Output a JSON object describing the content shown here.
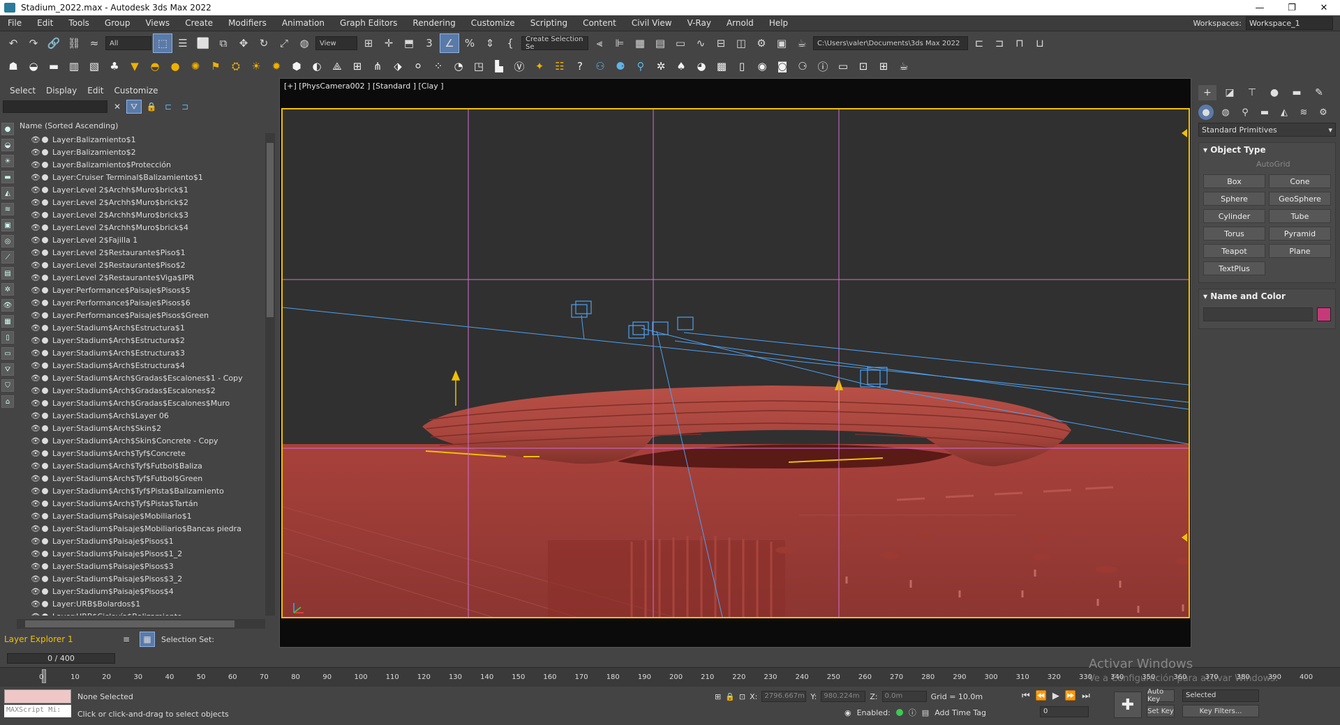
{
  "window": {
    "title": "Stadium_2022.max - Autodesk 3ds Max 2022",
    "min": "—",
    "restore": "❐",
    "close": "✕"
  },
  "menu": [
    "File",
    "Edit",
    "Tools",
    "Group",
    "Views",
    "Create",
    "Modifiers",
    "Animation",
    "Graph Editors",
    "Rendering",
    "Customize",
    "Scripting",
    "Content",
    "Civil View",
    "V-Ray",
    "Arnold",
    "Help"
  ],
  "workspace": {
    "label": "Workspaces:",
    "value": "Workspace_1"
  },
  "toolbar1": {
    "filter": "All",
    "view": "View",
    "selection_set": "Create Selection Se",
    "path": "C:\\Users\\valer\\Documents\\3ds Max 2022"
  },
  "scene_explorer": {
    "tabs": [
      "Select",
      "Display",
      "Edit",
      "Customize"
    ],
    "column_header": "Name (Sorted Ascending)",
    "layers": [
      "Layer:Balizamiento$1",
      "Layer:Balizamiento$2",
      "Layer:Balizamiento$Protección",
      "Layer:Cruiser Terminal$Balizamiento$1",
      "Layer:Level 2$Archh$Muro$brick$1",
      "Layer:Level 2$Archh$Muro$brick$2",
      "Layer:Level 2$Archh$Muro$brick$3",
      "Layer:Level 2$Archh$Muro$brick$4",
      "Layer:Level 2$Fajilla 1",
      "Layer:Level 2$Restaurante$Piso$1",
      "Layer:Level 2$Restaurante$Piso$2",
      "Layer:Level 2$Restaurante$Viga$IPR",
      "Layer:Performance$Paisaje$Pisos$5",
      "Layer:Performance$Paisaje$Pisos$6",
      "Layer:Performance$Paisaje$Pisos$Green",
      "Layer:Stadium$Arch$Estructura$1",
      "Layer:Stadium$Arch$Estructura$2",
      "Layer:Stadium$Arch$Estructura$3",
      "Layer:Stadium$Arch$Estructura$4",
      "Layer:Stadium$Arch$Gradas$Escalones$1 - Copy",
      "Layer:Stadium$Arch$Gradas$Escalones$2",
      "Layer:Stadium$Arch$Gradas$Escalones$Muro",
      "Layer:Stadium$Arch$Layer 06",
      "Layer:Stadium$Arch$Skin$2",
      "Layer:Stadium$Arch$Skin$Concrete - Copy",
      "Layer:Stadium$Arch$Tyf$Concrete",
      "Layer:Stadium$Arch$Tyf$Futbol$Baliza",
      "Layer:Stadium$Arch$Tyf$Futbol$Green",
      "Layer:Stadium$Arch$Tyf$Pista$Balizamiento",
      "Layer:Stadium$Arch$Tyf$Pista$Tartán",
      "Layer:Stadium$Paisaje$Mobiliario$1",
      "Layer:Stadium$Paisaje$Mobiliario$Bancas piedra",
      "Layer:Stadium$Paisaje$Pisos$1",
      "Layer:Stadium$Paisaje$Pisos$1_2",
      "Layer:Stadium$Paisaje$Pisos$3",
      "Layer:Stadium$Paisaje$Pisos$3_2",
      "Layer:Stadium$Paisaje$Pisos$4",
      "Layer:URB$Bolardos$1",
      "Layer:URB$Ciclovía$Balizamiento"
    ],
    "explorer_name": "Layer Explorer 1",
    "selection_set_label": "Selection Set:"
  },
  "viewport": {
    "label": "[+] [PhysCamera002 ] [Standard ] [Clay ]",
    "axis_label": "x"
  },
  "command_panel": {
    "category": "Standard Primitives",
    "rollout_object_type": "Object Type",
    "autogrid": "AutoGrid",
    "primitives": [
      "Box",
      "Cone",
      "Sphere",
      "GeoSphere",
      "Cylinder",
      "Tube",
      "Torus",
      "Pyramid",
      "Teapot",
      "Plane",
      "TextPlus"
    ],
    "rollout_name_color": "Name and Color",
    "object_color": "#c63a7a"
  },
  "timeline": {
    "slider": "0 / 400",
    "ticks": [
      "0",
      "10",
      "20",
      "30",
      "40",
      "50",
      "60",
      "70",
      "80",
      "90",
      "100",
      "110",
      "120",
      "130",
      "140",
      "150",
      "160",
      "170",
      "180",
      "190",
      "200",
      "210",
      "220",
      "230",
      "240",
      "250",
      "260",
      "270",
      "280",
      "290",
      "300",
      "310",
      "320",
      "330",
      "340",
      "350",
      "360",
      "370",
      "380",
      "390",
      "400"
    ]
  },
  "status": {
    "maxscript": "MAXScript Mi:",
    "selection": "None Selected",
    "prompt": "Click or click-and-drag to select objects",
    "x_label": "X:",
    "x_value": "2796.667m",
    "y_label": "Y:",
    "y_value": "980.224m",
    "z_label": "Z:",
    "z_value": "0.0m",
    "grid": "Grid = 10.0m",
    "enabled": "Enabled:",
    "add_time_tag": "Add Time Tag",
    "auto_key": "Auto Key",
    "set_key": "Set Key",
    "selected": "Selected",
    "key_filters": "Key Filters...",
    "frame": "0"
  },
  "watermark": {
    "line1": "Activar Windows",
    "line2": "Ve a Configuración para activar Windows."
  }
}
